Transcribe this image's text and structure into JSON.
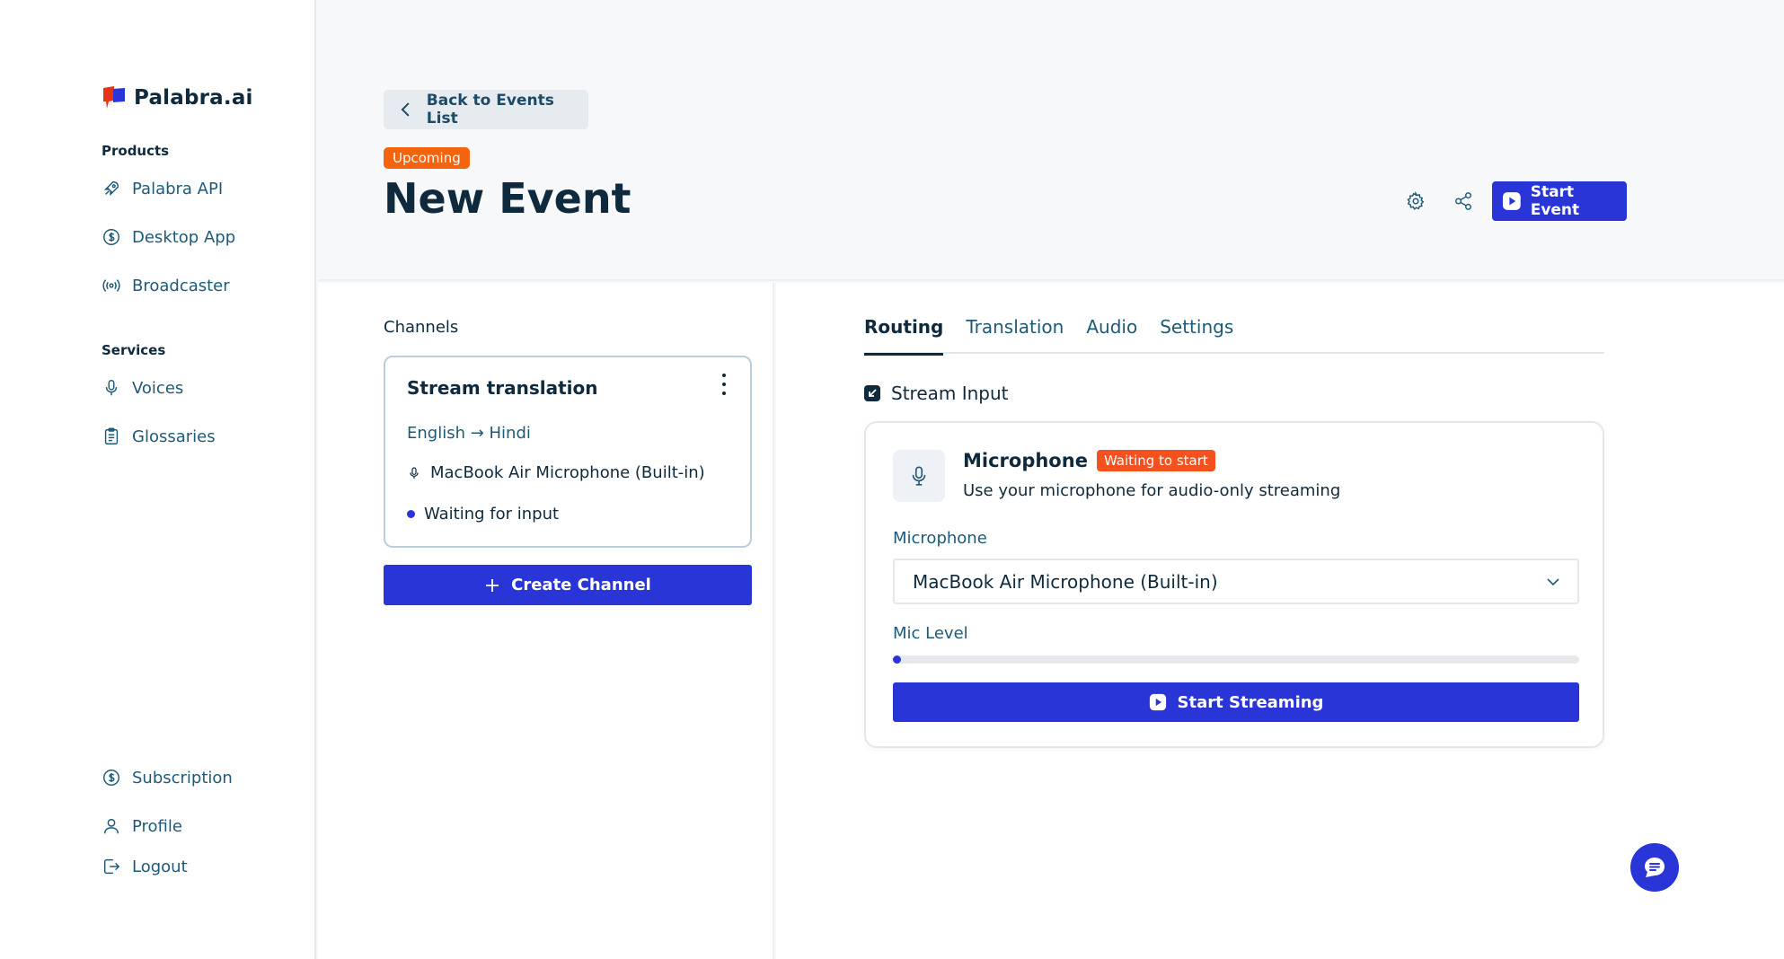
{
  "brand": {
    "name": "Palabra.ai",
    "colors": {
      "accent": "#2a35d8",
      "logo_red": "#e63312",
      "logo_blue": "#2a35d8",
      "badge_orange": "#f4640f"
    }
  },
  "sidebar": {
    "products_label": "Products",
    "products": [
      {
        "label": "Palabra API",
        "icon": "rocket-icon"
      },
      {
        "label": "Desktop App",
        "icon": "dollar-circle-icon"
      },
      {
        "label": "Broadcaster",
        "icon": "broadcast-icon"
      }
    ],
    "services_label": "Services",
    "services": [
      {
        "label": "Voices",
        "icon": "microphone-icon"
      },
      {
        "label": "Glossaries",
        "icon": "clipboard-icon"
      }
    ],
    "bottom": [
      {
        "label": "Subscription",
        "icon": "dollar-circle-icon"
      },
      {
        "label": "Profile",
        "icon": "user-icon"
      },
      {
        "label": "Logout",
        "icon": "logout-icon"
      }
    ]
  },
  "header": {
    "back_label": "Back to Events List",
    "status_badge": "Upcoming",
    "title": "New Event",
    "start_event_label": "Start Event"
  },
  "channels": {
    "label": "Channels",
    "items": [
      {
        "title": "Stream translation",
        "languages": "English → Hindi",
        "input": "MacBook Air Microphone (Built-in)",
        "status": "Waiting for input"
      }
    ],
    "create_label": "Create Channel"
  },
  "tabs": [
    {
      "label": "Routing",
      "active": true
    },
    {
      "label": "Translation",
      "active": false
    },
    {
      "label": "Audio",
      "active": false
    },
    {
      "label": "Settings",
      "active": false
    }
  ],
  "routing": {
    "section_label": "Stream Input",
    "source": {
      "title": "Microphone",
      "badge": "Waiting to start",
      "description": "Use your microphone for audio-only streaming"
    },
    "mic_field_label": "Microphone",
    "mic_selected": "MacBook Air Microphone (Built-in)",
    "mic_level_label": "Mic Level",
    "mic_level_fraction": 0.01,
    "start_label": "Start Streaming"
  }
}
